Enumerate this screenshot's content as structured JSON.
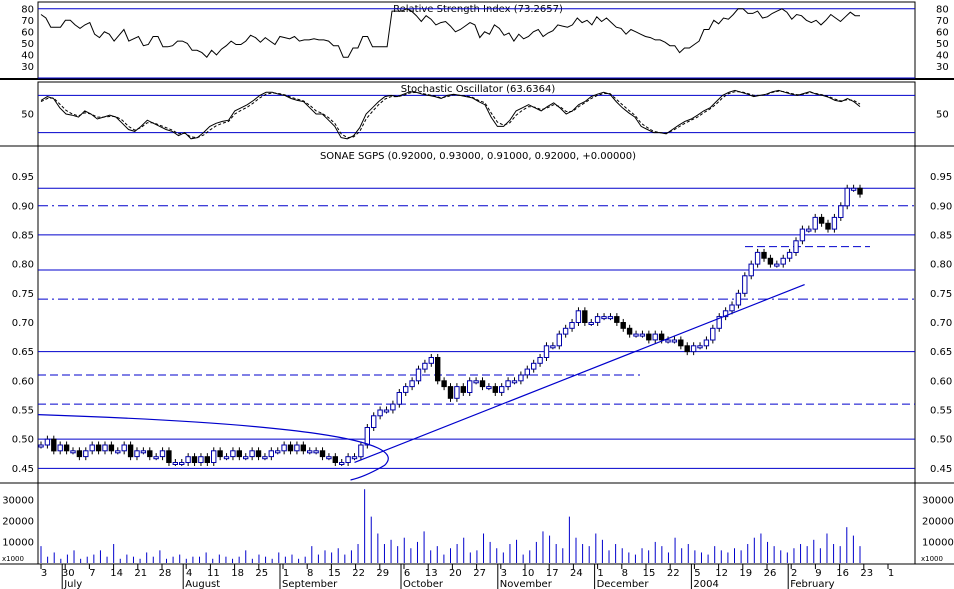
{
  "chart_data": {
    "type": "candlestick",
    "panels": {
      "rsi": {
        "title": "Relative Strength Index (73.2657)",
        "ylim": [
          20,
          85
        ],
        "ticks": [
          30,
          40,
          50,
          60,
          70,
          80
        ],
        "levels": [
          80,
          20
        ],
        "values": [
          75,
          72,
          64,
          64,
          64,
          70,
          70,
          66,
          63,
          66,
          68,
          58,
          55,
          60,
          58,
          52,
          57,
          62,
          52,
          54,
          56,
          48,
          49,
          56,
          56,
          47,
          47,
          48,
          52,
          52,
          50,
          44,
          44,
          42,
          38,
          44,
          40,
          45,
          48,
          52,
          49,
          49,
          52,
          57,
          55,
          51,
          55,
          52,
          49,
          56,
          55,
          54,
          56,
          52,
          53,
          53,
          54,
          53,
          53,
          52,
          48,
          48,
          38,
          38,
          46,
          46,
          56,
          56,
          47,
          47,
          47,
          47,
          78,
          78,
          78,
          80,
          78,
          74,
          69,
          74,
          71,
          66,
          68,
          69,
          65,
          60,
          62,
          65,
          68,
          66,
          55,
          60,
          58,
          66,
          63,
          57,
          59,
          52,
          58,
          54,
          56,
          60,
          62,
          56,
          59,
          61,
          66,
          65,
          64,
          66,
          72,
          68,
          70,
          66,
          73,
          69,
          72,
          68,
          64,
          63,
          58,
          62,
          60,
          58,
          56,
          55,
          53,
          53,
          51,
          48,
          48,
          42,
          46,
          46,
          49,
          52,
          62,
          62,
          70,
          67,
          72,
          71,
          75,
          80,
          80,
          76,
          76,
          78,
          72,
          73,
          76,
          78,
          80,
          77,
          71,
          75,
          74,
          70,
          68,
          70,
          66,
          70,
          75,
          72,
          69,
          73,
          77,
          74,
          74
        ]
      },
      "stochastic": {
        "title": "Stochastic Oscillator (63.6364)",
        "ylim": [
          0,
          100
        ],
        "ticks": [
          50
        ],
        "levels": [
          80,
          20
        ],
        "k": [
          72,
          78,
          75,
          60,
          50,
          48,
          45,
          55,
          50,
          42,
          45,
          48,
          45,
          35,
          25,
          22,
          30,
          40,
          35,
          30,
          25,
          22,
          15,
          20,
          10,
          12,
          20,
          30,
          35,
          38,
          40,
          55,
          60,
          65,
          72,
          80,
          85,
          85,
          82,
          80,
          75,
          72,
          70,
          60,
          50,
          50,
          40,
          30,
          12,
          10,
          15,
          28,
          50,
          60,
          70,
          78,
          80,
          78,
          82,
          86,
          85,
          82,
          80,
          78,
          75,
          80,
          82,
          80,
          78,
          76,
          70,
          65,
          45,
          30,
          30,
          40,
          55,
          60,
          65,
          60,
          55,
          62,
          68,
          60,
          50,
          55,
          65,
          70,
          78,
          82,
          85,
          82,
          70,
          60,
          52,
          45,
          30,
          25,
          20,
          20,
          18,
          25,
          32,
          38,
          42,
          48,
          55,
          60,
          70,
          80,
          85,
          88,
          85,
          82,
          78,
          80,
          82,
          86,
          88,
          85,
          82,
          80,
          83,
          86,
          82,
          80,
          77,
          72,
          70,
          75,
          70,
          62
        ],
        "d": [
          70,
          75,
          76,
          66,
          56,
          50,
          47,
          52,
          50,
          45,
          45,
          46,
          46,
          40,
          30,
          24,
          28,
          36,
          36,
          32,
          28,
          24,
          18,
          19,
          13,
          12,
          16,
          24,
          31,
          35,
          38,
          50,
          56,
          61,
          68,
          76,
          82,
          84,
          83,
          81,
          77,
          74,
          71,
          64,
          55,
          51,
          44,
          35,
          18,
          12,
          13,
          22,
          42,
          54,
          65,
          74,
          78,
          78,
          80,
          84,
          85,
          83,
          81,
          79,
          76,
          78,
          81,
          80,
          79,
          77,
          72,
          68,
          52,
          37,
          32,
          36,
          48,
          56,
          62,
          61,
          57,
          60,
          65,
          62,
          54,
          54,
          62,
          68,
          75,
          80,
          83,
          83,
          74,
          65,
          56,
          48,
          35,
          28,
          22,
          20,
          19,
          23,
          29,
          35,
          40,
          45,
          52,
          58,
          66,
          76,
          83,
          86,
          86,
          83,
          80,
          80,
          81,
          85,
          87,
          86,
          83,
          81,
          82,
          85,
          83,
          81,
          78,
          74,
          71,
          73,
          72,
          66
        ]
      },
      "price": {
        "title": "SONAE SGPS (0.92000, 0.93000, 0.91000, 0.92000, +0.00000)",
        "ylim": [
          0.43,
          0.975
        ],
        "ticks": [
          0.45,
          0.5,
          0.55,
          0.6,
          0.65,
          0.7,
          0.75,
          0.8,
          0.85,
          0.9,
          0.95
        ],
        "x_tick_labels": [
          "3",
          "30",
          "7",
          "14",
          "21",
          "28",
          "4",
          "11",
          "18",
          "25",
          "1",
          "8",
          "15",
          "22",
          "29",
          "6",
          "13",
          "20",
          "27",
          "3",
          "10",
          "17",
          "24",
          "1",
          "8",
          "15",
          "22",
          "5",
          "12",
          "19",
          "26",
          "2",
          "9",
          "16",
          "23",
          "1"
        ],
        "month_labels": [
          "July",
          "August",
          "September",
          "October",
          "November",
          "December",
          "2004",
          "February"
        ],
        "solid_levels": [
          0.93,
          0.85,
          0.79,
          0.65,
          0.5,
          0.45
        ],
        "dashdot_levels": [
          0.9,
          0.74
        ],
        "dashed_levels": [
          0.61,
          0.56,
          0.83
        ],
        "trendline": {
          "from": {
            "bar": 49,
            "price": 0.46
          },
          "to": {
            "bar": 117,
            "price": 0.765
          }
        },
        "closes": [
          0.49,
          0.5,
          0.48,
          0.49,
          0.48,
          0.48,
          0.47,
          0.48,
          0.49,
          0.48,
          0.49,
          0.48,
          0.48,
          0.49,
          0.47,
          0.48,
          0.48,
          0.47,
          0.47,
          0.48,
          0.46,
          0.46,
          0.46,
          0.47,
          0.46,
          0.47,
          0.46,
          0.48,
          0.47,
          0.47,
          0.48,
          0.47,
          0.47,
          0.48,
          0.47,
          0.47,
          0.48,
          0.48,
          0.49,
          0.48,
          0.49,
          0.48,
          0.48,
          0.48,
          0.47,
          0.47,
          0.46,
          0.46,
          0.47,
          0.47,
          0.49,
          0.52,
          0.54,
          0.55,
          0.55,
          0.56,
          0.58,
          0.59,
          0.6,
          0.62,
          0.63,
          0.64,
          0.6,
          0.59,
          0.57,
          0.59,
          0.58,
          0.6,
          0.6,
          0.59,
          0.59,
          0.58,
          0.59,
          0.6,
          0.6,
          0.61,
          0.62,
          0.63,
          0.64,
          0.66,
          0.66,
          0.68,
          0.69,
          0.7,
          0.72,
          0.7,
          0.7,
          0.71,
          0.71,
          0.71,
          0.7,
          0.69,
          0.68,
          0.68,
          0.68,
          0.67,
          0.68,
          0.67,
          0.67,
          0.67,
          0.66,
          0.65,
          0.66,
          0.66,
          0.67,
          0.69,
          0.71,
          0.72,
          0.73,
          0.75,
          0.78,
          0.8,
          0.82,
          0.81,
          0.8,
          0.8,
          0.81,
          0.82,
          0.84,
          0.86,
          0.86,
          0.88,
          0.87,
          0.86,
          0.88,
          0.9,
          0.93,
          0.93,
          0.92
        ],
        "last_price": {
          "open": 0.92,
          "high": 0.93,
          "low": 0.91,
          "close": 0.92
        }
      },
      "volume": {
        "ticks": [
          10000,
          20000,
          30000
        ],
        "tick_labels": [
          "10000",
          "20000",
          "30000"
        ],
        "ylim": [
          0,
          37000
        ],
        "unit_label": "x1000",
        "values": [
          8000,
          3000,
          5000,
          2000,
          4000,
          6000,
          2000,
          3000,
          4000,
          6000,
          3000,
          9000,
          2000,
          4000,
          3000,
          2000,
          5000,
          3000,
          6000,
          2000,
          3000,
          4000,
          2000,
          3000,
          3000,
          5000,
          2000,
          4000,
          3000,
          2000,
          3000,
          6000,
          2000,
          4000,
          3000,
          2000,
          5000,
          3000,
          4000,
          2000,
          3000,
          8000,
          4000,
          6000,
          5000,
          7000,
          4000,
          6000,
          9000,
          35000,
          22000,
          14000,
          9000,
          11000,
          8000,
          12000,
          7000,
          10000,
          15000,
          6000,
          8000,
          4000,
          7000,
          9000,
          12000,
          5000,
          6000,
          14000,
          10000,
          7000,
          5000,
          9000,
          11000,
          4000,
          6000,
          10000,
          15000,
          13000,
          9000,
          7000,
          22000,
          12000,
          9000,
          8000,
          14000,
          11000,
          6000,
          9000,
          7000,
          5000,
          4000,
          7000,
          6000,
          10000,
          8000,
          5000,
          12000,
          7000,
          9000,
          6000,
          5000,
          4000,
          8000,
          6000,
          5000,
          7000,
          6000,
          9000,
          12000,
          14000,
          10000,
          8000,
          6000,
          5000,
          7000,
          9000,
          8000,
          11000,
          7000,
          14000,
          9000,
          8000,
          17000,
          13000,
          8000
        ]
      }
    }
  }
}
